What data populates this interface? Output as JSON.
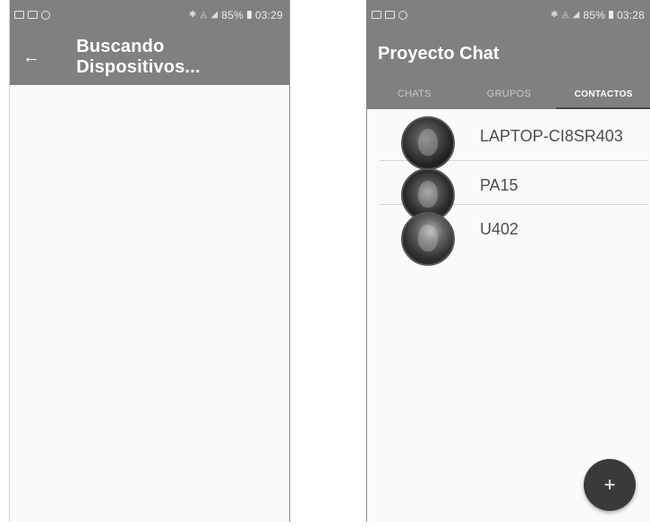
{
  "left_screen": {
    "status": {
      "battery_text": "85%",
      "time": "03:29"
    },
    "toolbar": {
      "title": "Buscando Dispositivos..."
    }
  },
  "right_screen": {
    "status": {
      "battery_text": "85%",
      "time": "03:28"
    },
    "toolbar": {
      "title": "Proyecto Chat"
    },
    "tabs": [
      {
        "label": "CHATS"
      },
      {
        "label": "GRUPOS"
      },
      {
        "label": "CONTACTOS"
      }
    ],
    "contacts": [
      {
        "name": "LAPTOP-CI8SR403"
      },
      {
        "name": "PA15"
      },
      {
        "name": "U402"
      }
    ],
    "fab": {
      "symbol": "+"
    }
  },
  "icons": {
    "back": "arrow-left-icon",
    "fab": "plus-icon"
  },
  "colors": {
    "toolbar": "#808080",
    "tab_indicator": "#4a4a4a",
    "fab": "#3a3a3a",
    "background": "#fafafa"
  }
}
